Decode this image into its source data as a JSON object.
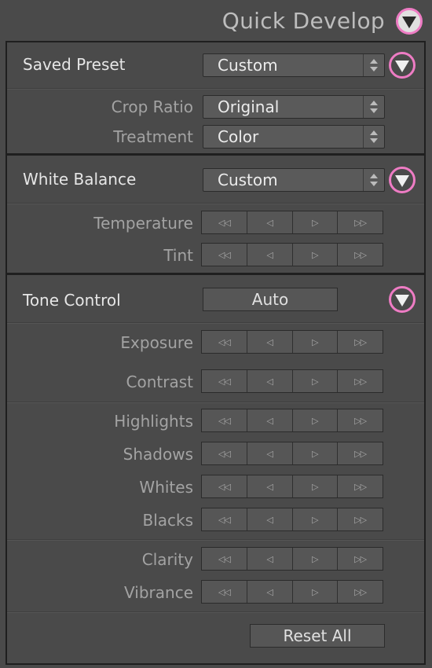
{
  "header": {
    "title": "Quick Develop"
  },
  "saved_preset": {
    "label": "Saved Preset",
    "value": "Custom",
    "rows": [
      {
        "label": "Crop Ratio",
        "value": "Original"
      },
      {
        "label": "Treatment",
        "value": "Color"
      }
    ]
  },
  "white_balance": {
    "label": "White Balance",
    "value": "Custom",
    "rows": [
      {
        "label": "Temperature"
      },
      {
        "label": "Tint"
      }
    ]
  },
  "tone_control": {
    "label": "Tone Control",
    "auto_label": "Auto",
    "rows": [
      {
        "label": "Exposure"
      },
      {
        "label": "Contrast"
      },
      {
        "label": "Highlights"
      },
      {
        "label": "Shadows"
      },
      {
        "label": "Whites"
      },
      {
        "label": "Blacks"
      },
      {
        "label": "Clarity"
      },
      {
        "label": "Vibrance"
      }
    ],
    "reset_label": "Reset All"
  },
  "stepper_glyphs": {
    "big_left": "◁◁",
    "left": "◁",
    "right": "▷",
    "big_right": "▷▷"
  },
  "colors": {
    "highlight_ring": "#ee7cc4",
    "panel_bg": "#4a4a4a"
  }
}
